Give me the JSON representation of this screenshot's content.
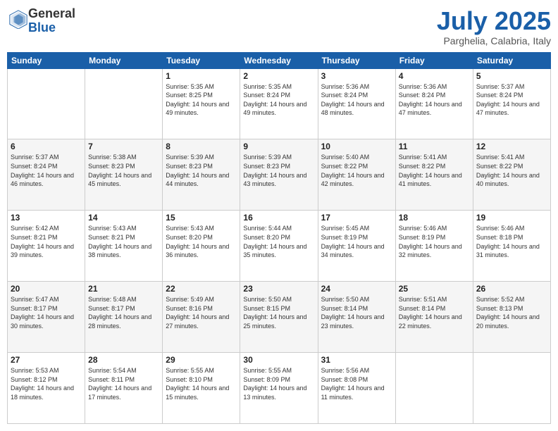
{
  "header": {
    "logo_general": "General",
    "logo_blue": "Blue",
    "month": "July 2025",
    "location": "Parghelia, Calabria, Italy"
  },
  "weekdays": [
    "Sunday",
    "Monday",
    "Tuesday",
    "Wednesday",
    "Thursday",
    "Friday",
    "Saturday"
  ],
  "weeks": [
    [
      {
        "day": "",
        "sunrise": "",
        "sunset": "",
        "daylight": ""
      },
      {
        "day": "",
        "sunrise": "",
        "sunset": "",
        "daylight": ""
      },
      {
        "day": "1",
        "sunrise": "Sunrise: 5:35 AM",
        "sunset": "Sunset: 8:25 PM",
        "daylight": "Daylight: 14 hours and 49 minutes."
      },
      {
        "day": "2",
        "sunrise": "Sunrise: 5:35 AM",
        "sunset": "Sunset: 8:24 PM",
        "daylight": "Daylight: 14 hours and 49 minutes."
      },
      {
        "day": "3",
        "sunrise": "Sunrise: 5:36 AM",
        "sunset": "Sunset: 8:24 PM",
        "daylight": "Daylight: 14 hours and 48 minutes."
      },
      {
        "day": "4",
        "sunrise": "Sunrise: 5:36 AM",
        "sunset": "Sunset: 8:24 PM",
        "daylight": "Daylight: 14 hours and 47 minutes."
      },
      {
        "day": "5",
        "sunrise": "Sunrise: 5:37 AM",
        "sunset": "Sunset: 8:24 PM",
        "daylight": "Daylight: 14 hours and 47 minutes."
      }
    ],
    [
      {
        "day": "6",
        "sunrise": "Sunrise: 5:37 AM",
        "sunset": "Sunset: 8:24 PM",
        "daylight": "Daylight: 14 hours and 46 minutes."
      },
      {
        "day": "7",
        "sunrise": "Sunrise: 5:38 AM",
        "sunset": "Sunset: 8:23 PM",
        "daylight": "Daylight: 14 hours and 45 minutes."
      },
      {
        "day": "8",
        "sunrise": "Sunrise: 5:39 AM",
        "sunset": "Sunset: 8:23 PM",
        "daylight": "Daylight: 14 hours and 44 minutes."
      },
      {
        "day": "9",
        "sunrise": "Sunrise: 5:39 AM",
        "sunset": "Sunset: 8:23 PM",
        "daylight": "Daylight: 14 hours and 43 minutes."
      },
      {
        "day": "10",
        "sunrise": "Sunrise: 5:40 AM",
        "sunset": "Sunset: 8:22 PM",
        "daylight": "Daylight: 14 hours and 42 minutes."
      },
      {
        "day": "11",
        "sunrise": "Sunrise: 5:41 AM",
        "sunset": "Sunset: 8:22 PM",
        "daylight": "Daylight: 14 hours and 41 minutes."
      },
      {
        "day": "12",
        "sunrise": "Sunrise: 5:41 AM",
        "sunset": "Sunset: 8:22 PM",
        "daylight": "Daylight: 14 hours and 40 minutes."
      }
    ],
    [
      {
        "day": "13",
        "sunrise": "Sunrise: 5:42 AM",
        "sunset": "Sunset: 8:21 PM",
        "daylight": "Daylight: 14 hours and 39 minutes."
      },
      {
        "day": "14",
        "sunrise": "Sunrise: 5:43 AM",
        "sunset": "Sunset: 8:21 PM",
        "daylight": "Daylight: 14 hours and 38 minutes."
      },
      {
        "day": "15",
        "sunrise": "Sunrise: 5:43 AM",
        "sunset": "Sunset: 8:20 PM",
        "daylight": "Daylight: 14 hours and 36 minutes."
      },
      {
        "day": "16",
        "sunrise": "Sunrise: 5:44 AM",
        "sunset": "Sunset: 8:20 PM",
        "daylight": "Daylight: 14 hours and 35 minutes."
      },
      {
        "day": "17",
        "sunrise": "Sunrise: 5:45 AM",
        "sunset": "Sunset: 8:19 PM",
        "daylight": "Daylight: 14 hours and 34 minutes."
      },
      {
        "day": "18",
        "sunrise": "Sunrise: 5:46 AM",
        "sunset": "Sunset: 8:19 PM",
        "daylight": "Daylight: 14 hours and 32 minutes."
      },
      {
        "day": "19",
        "sunrise": "Sunrise: 5:46 AM",
        "sunset": "Sunset: 8:18 PM",
        "daylight": "Daylight: 14 hours and 31 minutes."
      }
    ],
    [
      {
        "day": "20",
        "sunrise": "Sunrise: 5:47 AM",
        "sunset": "Sunset: 8:17 PM",
        "daylight": "Daylight: 14 hours and 30 minutes."
      },
      {
        "day": "21",
        "sunrise": "Sunrise: 5:48 AM",
        "sunset": "Sunset: 8:17 PM",
        "daylight": "Daylight: 14 hours and 28 minutes."
      },
      {
        "day": "22",
        "sunrise": "Sunrise: 5:49 AM",
        "sunset": "Sunset: 8:16 PM",
        "daylight": "Daylight: 14 hours and 27 minutes."
      },
      {
        "day": "23",
        "sunrise": "Sunrise: 5:50 AM",
        "sunset": "Sunset: 8:15 PM",
        "daylight": "Daylight: 14 hours and 25 minutes."
      },
      {
        "day": "24",
        "sunrise": "Sunrise: 5:50 AM",
        "sunset": "Sunset: 8:14 PM",
        "daylight": "Daylight: 14 hours and 23 minutes."
      },
      {
        "day": "25",
        "sunrise": "Sunrise: 5:51 AM",
        "sunset": "Sunset: 8:14 PM",
        "daylight": "Daylight: 14 hours and 22 minutes."
      },
      {
        "day": "26",
        "sunrise": "Sunrise: 5:52 AM",
        "sunset": "Sunset: 8:13 PM",
        "daylight": "Daylight: 14 hours and 20 minutes."
      }
    ],
    [
      {
        "day": "27",
        "sunrise": "Sunrise: 5:53 AM",
        "sunset": "Sunset: 8:12 PM",
        "daylight": "Daylight: 14 hours and 18 minutes."
      },
      {
        "day": "28",
        "sunrise": "Sunrise: 5:54 AM",
        "sunset": "Sunset: 8:11 PM",
        "daylight": "Daylight: 14 hours and 17 minutes."
      },
      {
        "day": "29",
        "sunrise": "Sunrise: 5:55 AM",
        "sunset": "Sunset: 8:10 PM",
        "daylight": "Daylight: 14 hours and 15 minutes."
      },
      {
        "day": "30",
        "sunrise": "Sunrise: 5:55 AM",
        "sunset": "Sunset: 8:09 PM",
        "daylight": "Daylight: 14 hours and 13 minutes."
      },
      {
        "day": "31",
        "sunrise": "Sunrise: 5:56 AM",
        "sunset": "Sunset: 8:08 PM",
        "daylight": "Daylight: 14 hours and 11 minutes."
      },
      {
        "day": "",
        "sunrise": "",
        "sunset": "",
        "daylight": ""
      },
      {
        "day": "",
        "sunrise": "",
        "sunset": "",
        "daylight": ""
      }
    ]
  ]
}
